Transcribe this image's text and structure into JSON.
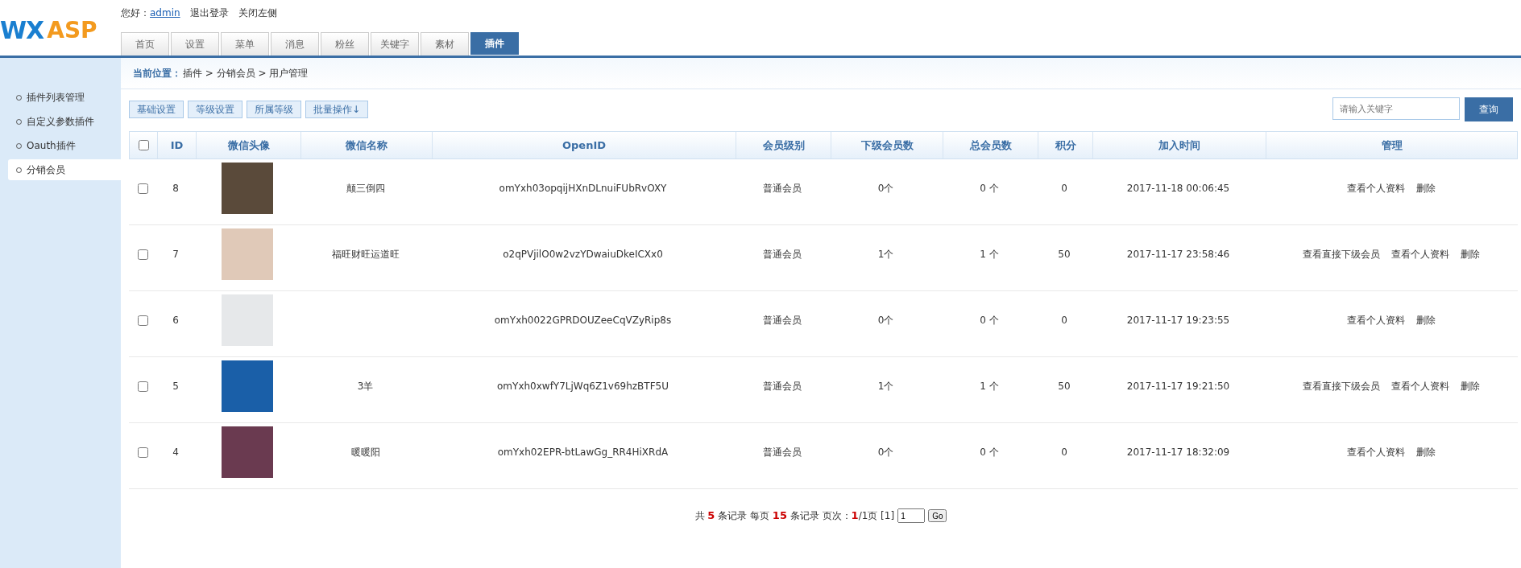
{
  "logo": {
    "part_1": "WX",
    "part_2": "ASP"
  },
  "user_bar": {
    "greeting": "您好：",
    "username": "admin",
    "links": [
      "退出登录",
      "关闭左侧"
    ]
  },
  "nav_tabs": [
    {
      "label": "首页",
      "selected": false
    },
    {
      "label": "设置",
      "selected": false
    },
    {
      "label": "菜单",
      "selected": false
    },
    {
      "label": "消息",
      "selected": false
    },
    {
      "label": "粉丝",
      "selected": false
    },
    {
      "label": "关键字",
      "selected": false
    },
    {
      "label": "素材",
      "selected": false
    },
    {
      "label": "插件",
      "selected": true
    }
  ],
  "sidebar": {
    "items": [
      {
        "label": "插件列表管理",
        "selected": false
      },
      {
        "label": "自定义参数插件",
        "selected": false
      },
      {
        "label": "Oauth插件",
        "selected": false
      },
      {
        "label": "分销会员",
        "selected": true
      }
    ]
  },
  "breadcrumb": {
    "label": "当前位置：",
    "path": "插件 > 分销会员 > 用户管理"
  },
  "toolbar": {
    "buttons": [
      "基础设置",
      "等级设置",
      "所属等级",
      "批量操作↓"
    ],
    "search": {
      "placeholder": "请输入关键字"
    },
    "search_button": "查询"
  },
  "table": {
    "select_all": {
      "checked": false
    },
    "columns": [
      "ID",
      "微信头像",
      "微信名称",
      "OpenID",
      "会员级别",
      "下级会员数",
      "总会员数",
      "积分",
      "加入时间",
      "管理"
    ],
    "rows": [
      {
        "checked": false,
        "id": "8",
        "nickname": "颠三倒四",
        "openid": "omYxh03opqijHXnDLnuiFUbRvOXY",
        "level": "普通会员",
        "sub_members": "0个",
        "total_members": "0 个",
        "points": "0",
        "joined": "2017-11-18 00:06:45",
        "actions": [
          "查看个人资料",
          "删除"
        ]
      },
      {
        "checked": false,
        "id": "7",
        "nickname": "福旺财旺运道旺",
        "openid": "o2qPVjilO0w2vzYDwaiuDkeICXx0",
        "level": "普通会员",
        "sub_members": "1个",
        "total_members": "1 个",
        "points": "50",
        "joined": "2017-11-17 23:58:46",
        "actions": [
          "查看直接下级会员",
          "查看个人资料",
          "删除"
        ]
      },
      {
        "checked": false,
        "id": "6",
        "openid": "omYxh0022GPRDOUZeeCqVZyRip8s",
        "level": "普通会员",
        "sub_members": "0个",
        "total_members": "0 个",
        "points": "0",
        "joined": "2017-11-17 19:23:55",
        "actions": [
          "查看个人资料",
          "删除"
        ]
      },
      {
        "checked": false,
        "id": "5",
        "nickname": "3羊",
        "openid": "omYxh0xwfY7LjWq6Z1v69hzBTF5U",
        "level": "普通会员",
        "sub_members": "1个",
        "total_members": "1 个",
        "points": "50",
        "joined": "2017-11-17 19:21:50",
        "actions": [
          "查看直接下级会员",
          "查看个人资料",
          "删除"
        ]
      },
      {
        "checked": false,
        "id": "4",
        "nickname": "暖暖阳",
        "openid": "omYxh02EPR-btLawGg_RR4HiXRdA",
        "level": "普通会员",
        "sub_members": "0个",
        "total_members": "0 个",
        "points": "0",
        "joined": "2017-11-17 18:32:09",
        "actions": [
          "查看个人资料",
          "删除"
        ]
      }
    ]
  },
  "pagination": {
    "summary": "共 **5** 条记录 每页 **15** 条记录 页次：**1**/1页 [1]",
    "page_input": "1",
    "go_button": "Go"
  }
}
